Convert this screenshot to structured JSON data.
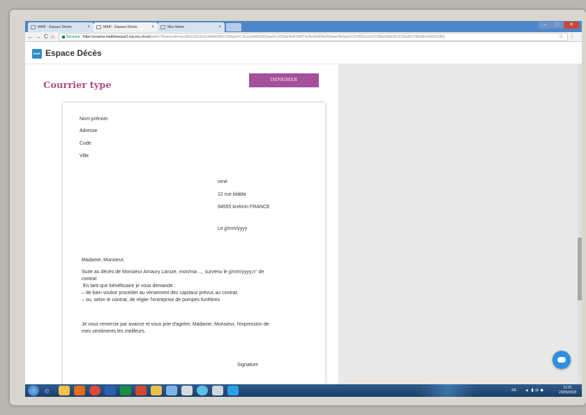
{
  "browser": {
    "tabs": [
      {
        "label": "MAIF - Espace Décès"
      },
      {
        "label": "MAIF - Espace Décès"
      },
      {
        "label": "Mes Notes"
      }
    ],
    "url_secure_label": "Sécurisé",
    "url_host": "https://yruama-maifobseque2.mycozy.cloud",
    "url_path": "/public?sharecode=eyJhbGciOiJIUzUxMiIsInR5cCI6IkpXVCJ9.eyJhdWQiOiJzaGFyZSIsImlhdCI6MTUyNzA2NDAyNSwiaXNzIjoieXJ1YW1hLm1SY296eS5jbG91ZCIsInN1YiI6InBhcnRhZ2UifQ",
    "nav": {
      "back": "←",
      "forward": "→",
      "reload": "C",
      "home": "⌂"
    },
    "star": "☆",
    "menu": "⋮"
  },
  "app": {
    "logo_text": "MAIF",
    "title": "Espace Décès"
  },
  "page": {
    "title": "Courrier type",
    "print_button": "IMPRIMER"
  },
  "letter": {
    "sender": [
      "Nom prénom",
      "Adresse",
      "Code",
      "Ville"
    ],
    "recipient": [
      "rené",
      "12 rue blabla",
      "94555 krelmin FRANCE"
    ],
    "date": "Le jj/mm/yyyy",
    "salutation": "Madame, Monsieur,",
    "body_line1": "Suite au décès de Monsieur Amaury Laroze, mon/ma ..., survenu le jj/mm/yyyy,n° de",
    "body_line2": "contrat",
    "body_line3": " En tant que bénéficiaire je vous demande :",
    "body_line4": "– de bien vouloir procéder au versement des capitaux prévus au contrat,",
    "body_line5": "– ou, selon le contrat, de régler l'entreprise de pompes funèbres",
    "closing_line1": "Je vous remercie par avance et vous prie d'agréer, Madame, Monsieur, l'expression de",
    "closing_line2": "mes sentiments les meilleurs.",
    "signature": "Signature"
  },
  "taskbar": {
    "lang": "FR",
    "time": "11:31",
    "date": "23/05/2018"
  },
  "colors": {
    "accent": "#b24b8c",
    "button": "#a4509c",
    "taskbar": "#1d3e66"
  }
}
